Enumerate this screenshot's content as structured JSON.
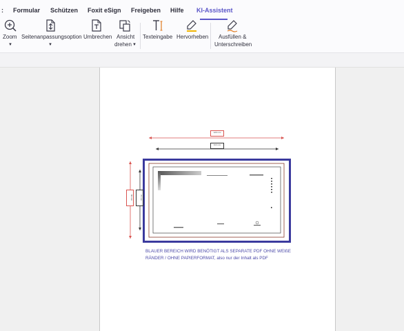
{
  "menu": {
    "items": [
      {
        "key": "colon",
        "label": ":"
      },
      {
        "key": "formular",
        "label": "Formular"
      },
      {
        "key": "schuetzen",
        "label": "Schützen"
      },
      {
        "key": "foxit_esign",
        "label": "Foxit eSign"
      },
      {
        "key": "freigeben",
        "label": "Freigeben"
      },
      {
        "key": "hilfe",
        "label": "Hilfe"
      },
      {
        "key": "ki_assistent",
        "label": "KI-Assistent"
      }
    ],
    "active": "KI-Assistent"
  },
  "ribbon": {
    "zoom": "Zoom",
    "seitenanpassung": "Seitenanpassungsoption",
    "umbrechen": "Umbrechen",
    "ansicht_line1": "Ansicht",
    "ansicht_line2": "drehen",
    "texteingabe": "Texteingabe",
    "hervorheben": "Hervorheben",
    "ausfuellen_line1": "Ausfüllen &",
    "ausfuellen_line2": "Unterschreiben"
  },
  "icons": {
    "zoom": "zoom-in-icon",
    "fit": "fit-page-icon",
    "reflow": "reflow-text-icon",
    "rotate": "rotate-view-icon",
    "typewriter": "text-input-icon",
    "highlight": "highlight-pen-icon",
    "sign": "fill-sign-icon"
  },
  "colors": {
    "accent": "#5a55c8",
    "frame_blue": "#3b3a9e",
    "dim_red": "#d9534f",
    "border_brown": "#8b3a2a",
    "note_text": "#4a48a8"
  },
  "document": {
    "dim_top_red": "120 mm",
    "dim_top_black": "110 mm",
    "dim_left_red": "80 mm",
    "dim_left_black": "70 mm",
    "note": "BLAUER BEREICH WIRD BENÖTIGT ALS SEPARATE PDF OHNE WEIßE RÄNDER / OHNE PAPIERFORMAT, also nur der Inhalt als PDF"
  }
}
